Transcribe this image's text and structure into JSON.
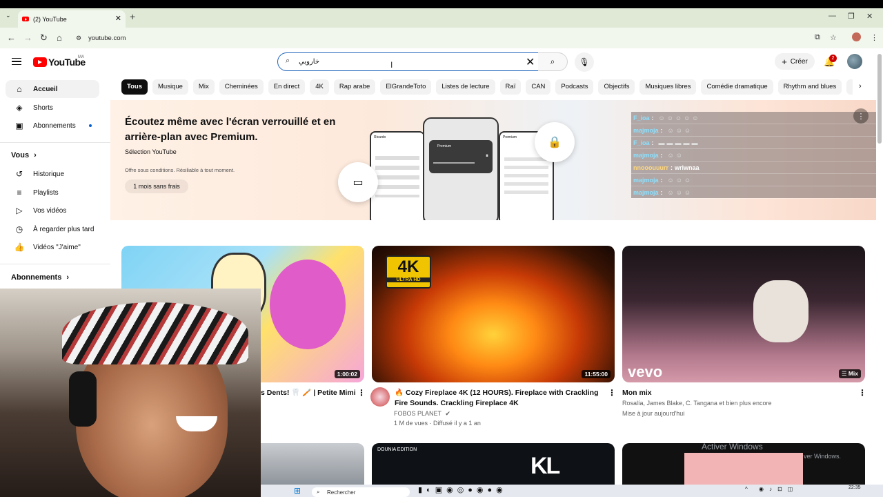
{
  "browser": {
    "tab_title": "(2) YouTube",
    "new_tab": "+",
    "url": "youtube.com"
  },
  "header": {
    "logo_text": "YouTube",
    "country_code": "MA",
    "search_value": "خاروبي",
    "create_label": "Créer",
    "notification_count": "2"
  },
  "sidebar": {
    "items": [
      {
        "label": "Accueil",
        "icon": "home-icon"
      },
      {
        "label": "Shorts",
        "icon": "shorts-icon"
      },
      {
        "label": "Abonnements",
        "icon": "subscriptions-icon"
      }
    ],
    "you_heading": "Vous",
    "you_items": [
      {
        "label": "Historique",
        "icon": "history-icon"
      },
      {
        "label": "Playlists",
        "icon": "playlists-icon"
      },
      {
        "label": "Vos vidéos",
        "icon": "your-videos-icon"
      },
      {
        "label": "À regarder plus tard",
        "icon": "watch-later-icon"
      },
      {
        "label": "Vidéos \"J'aime\"",
        "icon": "liked-icon"
      }
    ],
    "subs_heading": "Abonnements"
  },
  "chips": [
    "Tous",
    "Musique",
    "Mix",
    "Cheminées",
    "En direct",
    "4K",
    "Rap arabe",
    "ElGrandeToto",
    "Listes de lecture",
    "Raï",
    "CAN",
    "Podcasts",
    "Objectifs",
    "Musiques libres",
    "Comédie dramatique",
    "Rhythm and blues",
    "F"
  ],
  "banner": {
    "title": "Écoutez même avec l'écran verrouillé et en arrière-plan avec Premium.",
    "subtitle": "Sélection YouTube",
    "note": "Offre sous conditions. Résiliable à tout moment.",
    "button": "1 mois sans frais",
    "phone_l_label": "Ricardo",
    "phone_big_label": "Premium",
    "phone_r_label": "Premium"
  },
  "chat": [
    {
      "user": "F_ioa",
      "text": "",
      "emotes": "☺☺☺☺☺"
    },
    {
      "user": "majmoja",
      "text": "",
      "emotes": "☺☺☺"
    },
    {
      "user": "F_ioa",
      "text": "",
      "emotes": "▬▬▬▬▬"
    },
    {
      "user": "majmoja",
      "text": "",
      "emotes": "☺☺"
    },
    {
      "user": "nnooouuurr",
      "text": "wriwnaa",
      "emotes": ""
    },
    {
      "user": "majmoja",
      "text": "",
      "emotes": "☺☺☺"
    },
    {
      "user": "majmoja",
      "text": "",
      "emotes": "☺☺☺"
    }
  ],
  "videos": [
    {
      "title": "s Dents! 🦷 🪥 | Petite Mimi",
      "duration": "1:00:02"
    },
    {
      "title": "🔥 Cozy Fireplace 4K (12 HOURS). Fireplace with Crackling Fire Sounds. Crackling Fireplace 4K",
      "channel": "FOBOS PLANET",
      "meta": "1 M de vues · Diffusé il y a 1 an",
      "duration": "11:55:00",
      "badge": "4K",
      "badge_sub": "ULTRA HD"
    },
    {
      "title": "Mon mix",
      "channel": "Rosalía, James Blake, C. Tangana et bien plus encore",
      "meta": "Mise à jour aujourd'hui",
      "duration": "Mix",
      "logo": "vevo"
    }
  ],
  "row2": {
    "brand": "DOUNIA EDITION",
    "mark": "KL"
  },
  "windows": {
    "activate": "Activer Windows",
    "activate_sub": "ver Windows.",
    "search": "Rechercher",
    "time": "22:35"
  }
}
